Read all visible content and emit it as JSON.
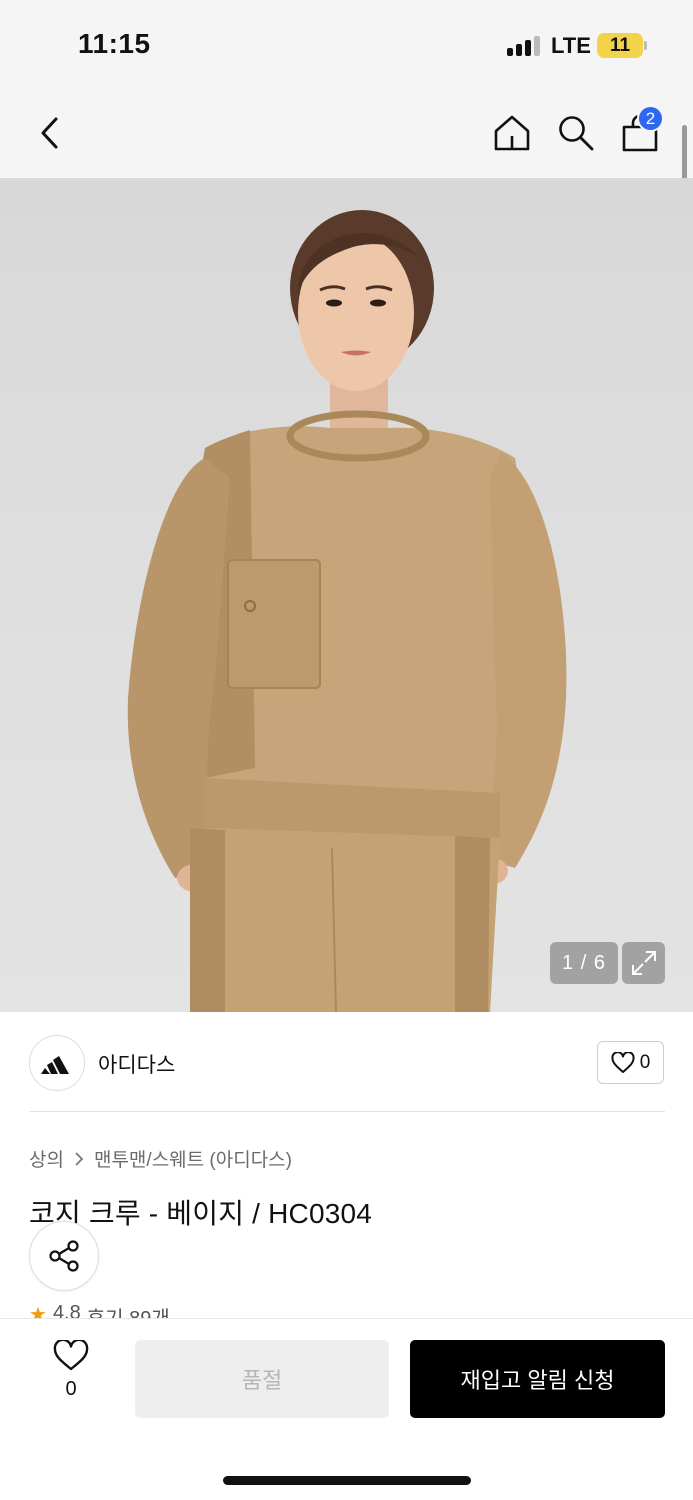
{
  "status_bar": {
    "time": "11:15",
    "network": "LTE",
    "battery": "11",
    "battery_color": "#f3d34a"
  },
  "nav": {
    "back_icon": "chevron-left-icon",
    "home_icon": "home-icon",
    "search_icon": "search-icon",
    "cart_icon": "shopping-bag-icon",
    "cart_count": "2",
    "badge_color": "#2e68f2"
  },
  "gallery": {
    "counter": "1 / 6",
    "expand_icon": "expand-icon"
  },
  "brand": {
    "name": "아디다스",
    "logo_icon": "adidas-logo",
    "like_count": "0"
  },
  "breadcrumb": {
    "category": "상의",
    "subcategory": "맨투맨/스웨트 (아디다스)"
  },
  "product": {
    "title": "코지 크루 - 베이지 / HC0304",
    "rating": "4.8",
    "reviews": "후기 89개"
  },
  "actions": {
    "wish_count": "0",
    "soldout_label": "품절",
    "restock_label": "재입고 알림 신청"
  }
}
